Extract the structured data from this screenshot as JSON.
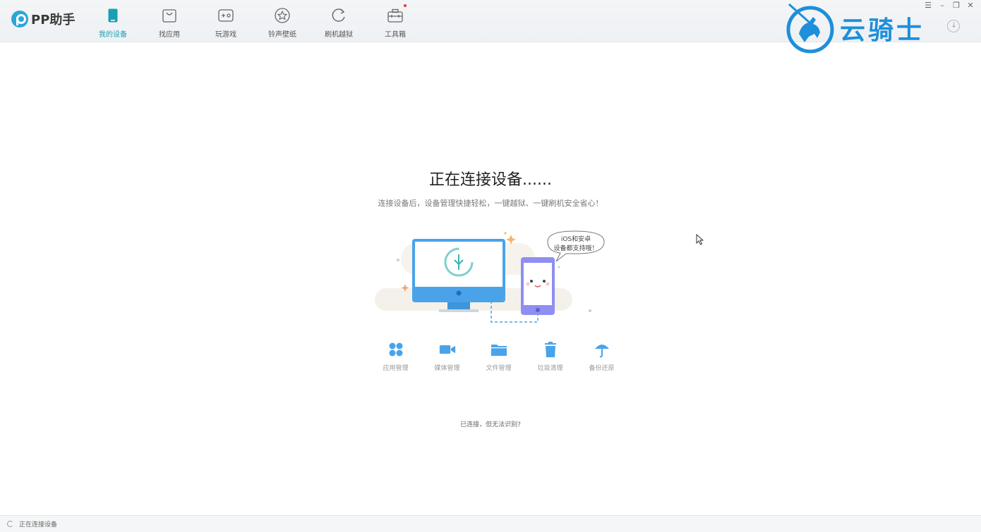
{
  "app": {
    "name": "PP助手"
  },
  "nav": [
    {
      "label": "我的设备",
      "icon": "phone-icon",
      "active": true
    },
    {
      "label": "找应用",
      "icon": "bag-icon"
    },
    {
      "label": "玩游戏",
      "icon": "gamepad-icon"
    },
    {
      "label": "铃声壁纸",
      "icon": "star-icon"
    },
    {
      "label": "刷机越狱",
      "icon": "refresh-icon"
    },
    {
      "label": "工具箱",
      "icon": "toolbox-icon",
      "badge": true
    }
  ],
  "window_controls": [
    "menu-icon",
    "minimize-icon",
    "restore-icon",
    "close-icon"
  ],
  "watermark": {
    "text": "云骑士"
  },
  "main": {
    "title": "正在连接设备......",
    "subtitle": "连接设备后，设备管理快捷轻松，一键越狱、一键刷机安全省心！",
    "bubble_text_line1": "iOS和安卓",
    "bubble_text_line2": "设备都支持哦！",
    "features": [
      {
        "label": "应用管理",
        "icon": "apps-grid-icon"
      },
      {
        "label": "媒体管理",
        "icon": "video-camera-icon"
      },
      {
        "label": "文件管理",
        "icon": "folder-icon"
      },
      {
        "label": "垃圾清理",
        "icon": "trash-icon"
      },
      {
        "label": "备份还原",
        "icon": "umbrella-icon"
      }
    ],
    "help_link": "已连接，但无法识别?"
  },
  "status": {
    "text": "正在连接设备"
  },
  "colors": {
    "accent": "#1a9fb3",
    "illustration_blue": "#4aa3e8",
    "watermark_blue": "#1d8fdb"
  }
}
